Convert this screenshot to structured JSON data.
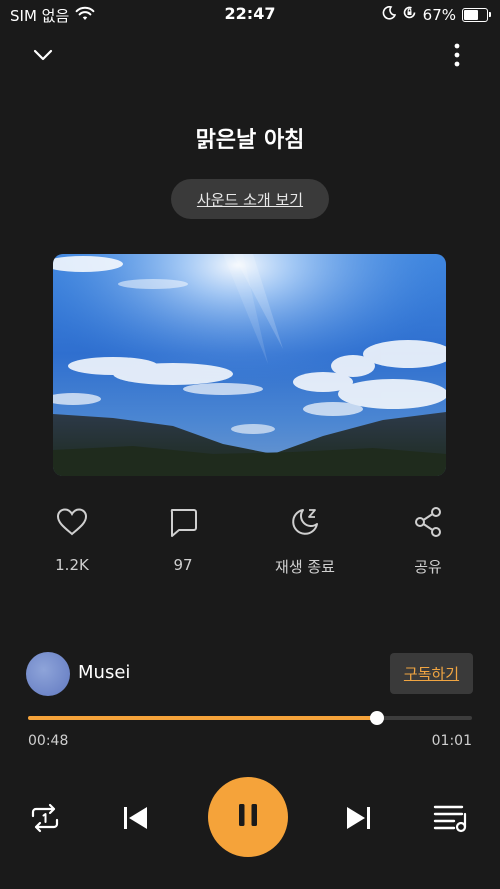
{
  "status_bar": {
    "carrier": "SIM 없음",
    "time": "22:47",
    "battery": "67%",
    "battery_level": 0.67,
    "icons": [
      "wifi-icon",
      "moon-icon",
      "rotation-lock-icon",
      "battery-icon"
    ]
  },
  "header": {
    "collapse_icon": "chevron-down-icon",
    "more_icon": "more-vertical-icon"
  },
  "title": "맑은날 아침",
  "sound_intro_label": "사운드 소개 보기",
  "cover": {
    "icon": "landscape-sky-image"
  },
  "actions": [
    {
      "icon": "heart-icon",
      "label": "1.2K"
    },
    {
      "icon": "comment-icon",
      "label": "97"
    },
    {
      "icon": "sleep-timer-icon",
      "label": "재생 종료"
    },
    {
      "icon": "share-icon",
      "label": "공유"
    }
  ],
  "artist": {
    "name": "Musei",
    "subscribe_label": "구독하기"
  },
  "player": {
    "current_time": "00:48",
    "total_time": "01:01",
    "progress": 0.787,
    "controls": [
      "repeat-one-icon",
      "previous-icon",
      "pause-icon",
      "next-icon",
      "playlist-icon"
    ]
  },
  "colors": {
    "background": "#1a1a1a",
    "accent": "#f5a33a",
    "button_bg": "#3a3a3a",
    "subscribe_text": "#f0a542"
  }
}
